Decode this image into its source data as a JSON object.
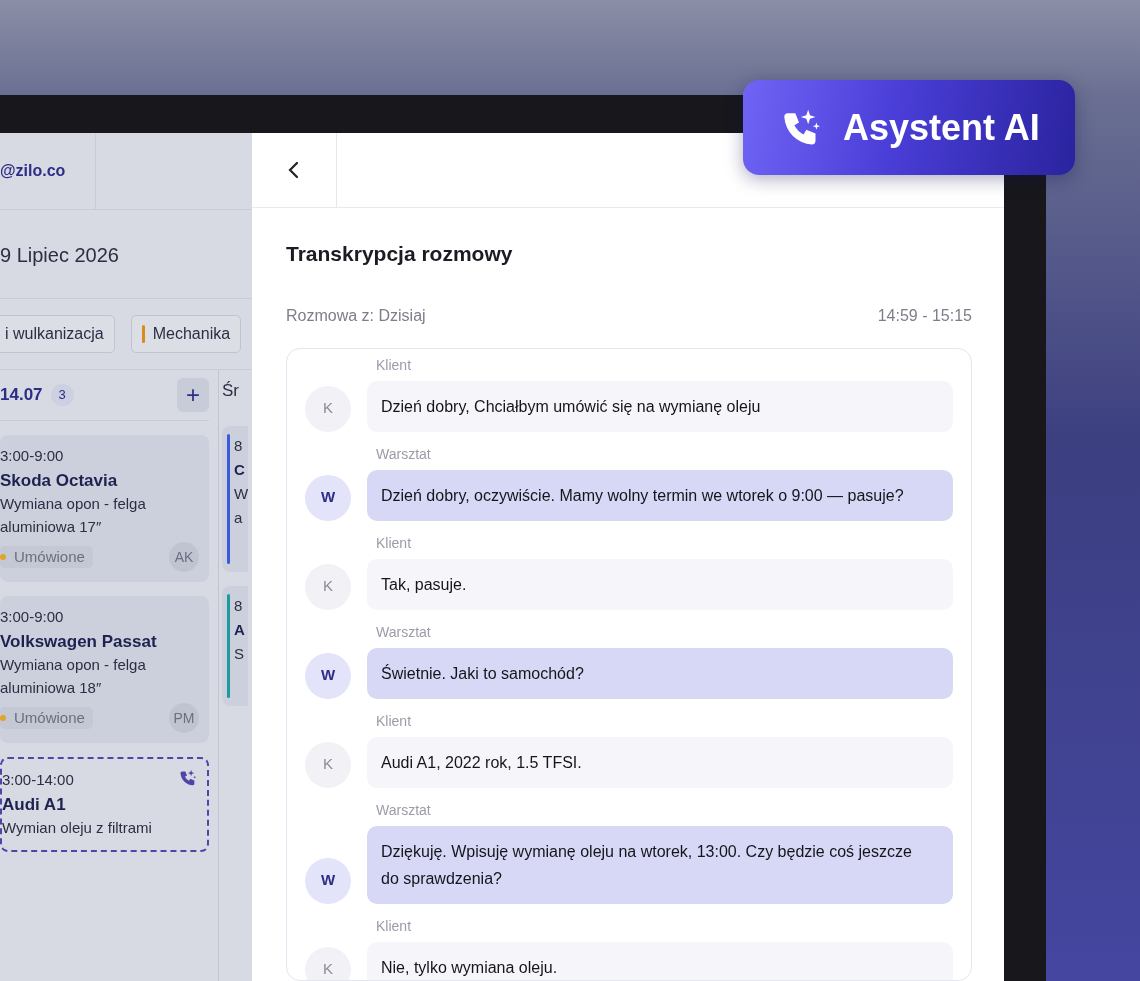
{
  "badge": {
    "label": "Asystent AI"
  },
  "background_app": {
    "account": "@zilo.co",
    "date": "9 Lipiec 2026",
    "filters": [
      {
        "label": "i wulkanizacja"
      },
      {
        "label": "Mechanika",
        "color": "#d98a1c"
      }
    ],
    "day": {
      "label": "14.07",
      "count": "3",
      "add": "+"
    },
    "next_day": "Śr",
    "appointments": [
      {
        "kind": "booked",
        "time": "3:00-9:00",
        "title": "Skoda Octavia",
        "lines": [
          "Wymiana opon - felga",
          "aluminiowa 17″"
        ],
        "status": {
          "label": "Umówione",
          "color": "#e0a526"
        },
        "initials": "AK"
      },
      {
        "kind": "booked",
        "time": "3:00-9:00",
        "title": "Volkswagen Passat",
        "lines": [
          "Wymiana opon - felga",
          "aluminiowa 18″"
        ],
        "status": {
          "label": "Umówione",
          "color": "#e0a526"
        },
        "initials": "PM"
      },
      {
        "kind": "ai_call",
        "time": "3:00-14:00",
        "title": "Audi A1",
        "lines": [
          "Wymian oleju z filtrami"
        ]
      }
    ],
    "next_column": [
      {
        "time": "8",
        "title": "C",
        "lines": [
          "W",
          "a"
        ],
        "color": "#3b5bdb"
      },
      {
        "time": "8",
        "title": "A",
        "lines": [
          "S"
        ],
        "color": "#1c9aa0"
      }
    ]
  },
  "panel": {
    "title": "Transkrypcja rozmowy",
    "subtitle": "Rozmowa z: Dzisiaj",
    "time_range": "14:59 - 15:15",
    "messages": [
      {
        "kind": "client",
        "speaker": "Klient",
        "avatar": "K",
        "text": "Dzień dobry, Chciałbym umówić się na wymianę oleju"
      },
      {
        "kind": "workshop",
        "speaker": "Warsztat",
        "avatar": "W",
        "text": "Dzień dobry, oczywiście. Mamy wolny termin we wtorek o 9:00 — pasuje?"
      },
      {
        "kind": "client",
        "speaker": "Klient",
        "avatar": "K",
        "text": "Tak, pasuje."
      },
      {
        "kind": "workshop",
        "speaker": "Warsztat",
        "avatar": "W",
        "text": "Świetnie. Jaki to samochód?"
      },
      {
        "kind": "client",
        "speaker": "Klient",
        "avatar": "K",
        "text": "Audi A1, 2022 rok, 1.5 TFSI."
      },
      {
        "kind": "workshop",
        "speaker": "Warsztat",
        "avatar": "W",
        "text": "Dziękuję. Wpisuję wymianę oleju na wtorek, 13:00. Czy będzie coś jeszcze do sprawdzenia?"
      },
      {
        "kind": "client",
        "speaker": "Klient",
        "avatar": "K",
        "text": "Nie, tylko wymiana oleju."
      }
    ]
  }
}
